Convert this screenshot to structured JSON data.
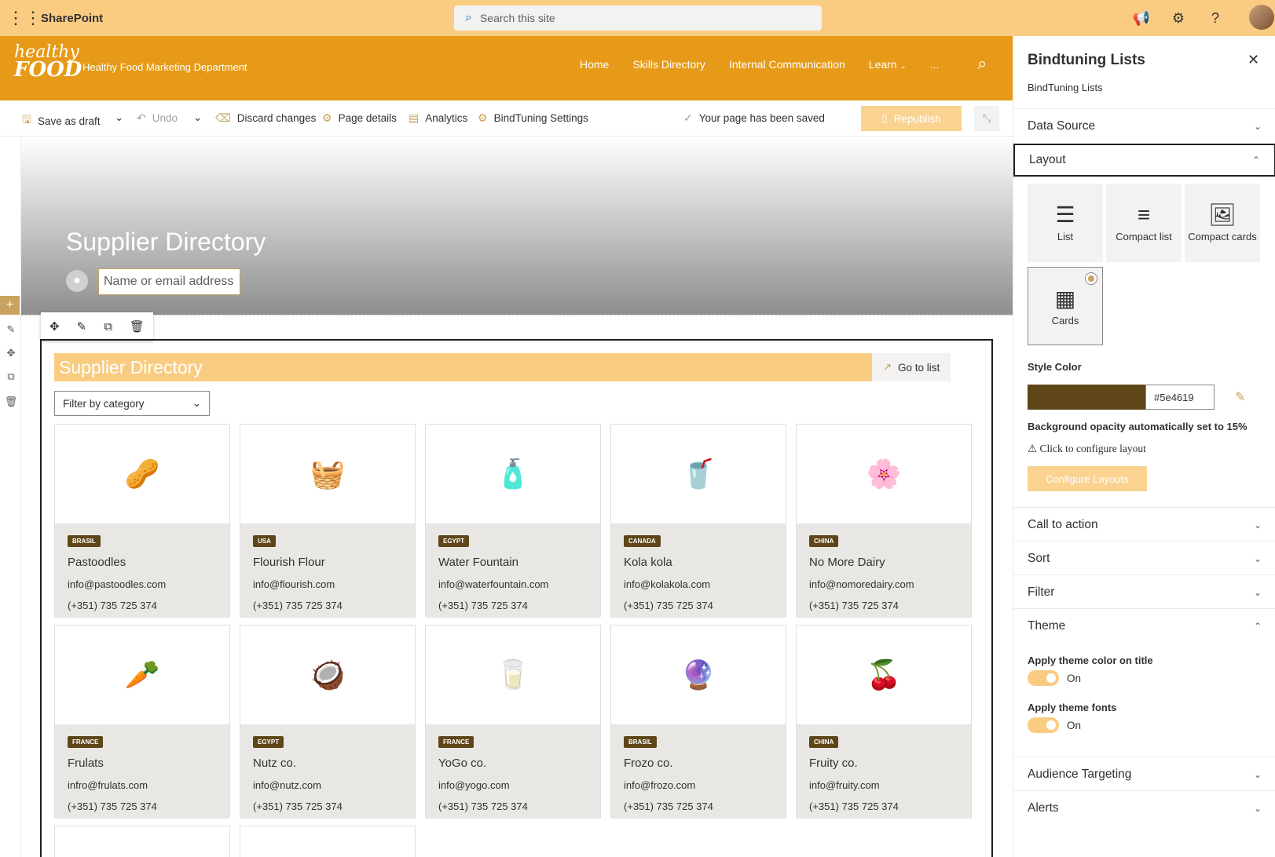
{
  "suite": {
    "app_name": "SharePoint",
    "search_placeholder": "Search this site"
  },
  "site": {
    "logo_line1": "healthy",
    "logo_line2": "FOOD",
    "name": "Healthy Food Marketing Department",
    "nav": [
      "Home",
      "Skills Directory",
      "Internal Communication",
      "Learn",
      "..."
    ]
  },
  "commands": {
    "save_draft": "Save as draft",
    "undo": "Undo",
    "discard": "Discard changes",
    "page_details": "Page details",
    "analytics": "Analytics",
    "bindtuning_settings": "BindTuning Settings",
    "saved_status": "Your page has been saved",
    "republish": "Republish"
  },
  "hero": {
    "title": "Supplier Directory",
    "author_placeholder": "Name or email address"
  },
  "webpart": {
    "title": "Supplier Directory",
    "go_to_list": "Go to list",
    "filter_label": "Filter by category",
    "cards": [
      {
        "country": "BRASIL",
        "name": "Pastoodles",
        "email": "info@pastoodles.com",
        "phone": "(+351) 735 725 374",
        "icon": "🥜"
      },
      {
        "country": "USA",
        "name": "Flourish Flour",
        "email": "info@flourish.com",
        "phone": "(+351) 735 725 374",
        "icon": "🧺"
      },
      {
        "country": "EGYPT",
        "name": "Water Fountain",
        "email": "info@waterfountain.com",
        "phone": "(+351) 735 725 374",
        "icon": "🧴"
      },
      {
        "country": "CANADA",
        "name": "Kola kola",
        "email": "info@kolakola.com",
        "phone": "(+351) 735 725 374",
        "icon": "🥤"
      },
      {
        "country": "CHINA",
        "name": "No More Dairy",
        "email": "info@nomoredairy.com",
        "phone": "(+351) 735 725 374",
        "icon": "🌸"
      },
      {
        "country": "FRANCE",
        "name": "Frulats",
        "email": "infro@frulats.com",
        "phone": "(+351) 735 725 374",
        "icon": "🥕"
      },
      {
        "country": "EGYPT",
        "name": "Nutz co.",
        "email": "info@nutz.com",
        "phone": "(+351) 735 725 374",
        "icon": "🥥"
      },
      {
        "country": "FRANCE",
        "name": "YoGo co.",
        "email": "info@yogo.com",
        "phone": "(+351) 735 725 374",
        "icon": "🥛"
      },
      {
        "country": "BRASIL",
        "name": "Frozo co.",
        "email": "info@frozo.com",
        "phone": "(+351) 735 725 374",
        "icon": "🔮"
      },
      {
        "country": "CHINA",
        "name": "Fruity co.",
        "email": "info@fruity.com",
        "phone": "(+351) 735 725 374",
        "icon": "🍒"
      }
    ]
  },
  "panel": {
    "title": "Bindtuning Lists",
    "subtitle": "BindTuning Lists",
    "sections": {
      "data_source": "Data Source",
      "layout": "Layout",
      "call_to_action": "Call to action",
      "sort": "Sort",
      "filter": "Filter",
      "theme": "Theme",
      "audience": "Audience Targeting",
      "alerts": "Alerts"
    },
    "layouts": {
      "list": "List",
      "compact_list": "Compact list",
      "compact_cards": "Compact cards",
      "cards": "Cards"
    },
    "style_color_label": "Style Color",
    "style_color_value": "#5e4619",
    "opacity_note": "Background opacity automatically set to 15%",
    "configure_note": "Click to configure layout",
    "configure_button": "Configure Layouts",
    "theme_title_label": "Apply theme color on title",
    "theme_title_state": "On",
    "theme_fonts_label": "Apply theme fonts",
    "theme_fonts_state": "On"
  },
  "colors": {
    "suite_bar": "#f9cc82",
    "site_header": "#e69a17",
    "style_color": "#5e4619",
    "accent": "#c8a25e"
  }
}
